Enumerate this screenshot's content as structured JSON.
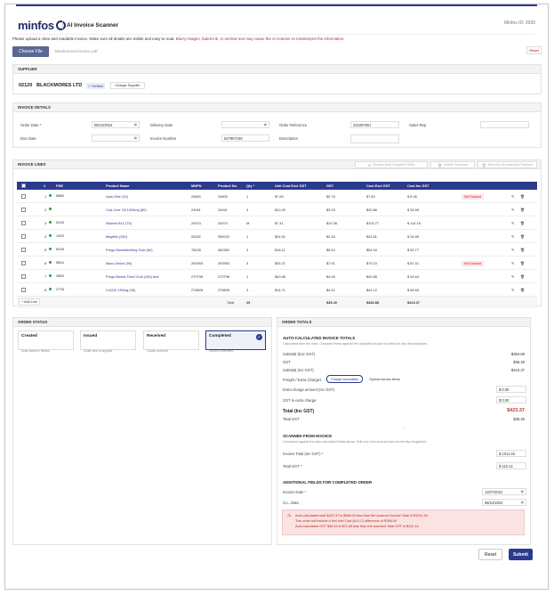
{
  "app": {
    "logo": "minfos",
    "title": "AI Invoice Scanner",
    "minfos_id": "Minfos ID: 2030"
  },
  "note": {
    "text": "Please upload a clear and readable invoice. Make sure all details are visible and easy to read. ",
    "warn": "Blurry images, faded ink, or unclear text may cause the AI scanner to misinterpret the information."
  },
  "file": {
    "button": "Choose File",
    "name": "Blackmores-invoice.pdf",
    "reset": "Reset"
  },
  "supplier": {
    "heading": "SUPPLIER",
    "code": "02120",
    "name": "BLACKMORES LTD",
    "badge": "Verified",
    "change": "Change Supplier"
  },
  "details": {
    "heading": "INVOICE DETAILS",
    "order_date_label": "Order Date *",
    "order_date": "08/12/2024",
    "delivery_date_label": "Delivery Date",
    "delivery_date": "",
    "order_ref_label": "Order Reference",
    "order_ref": "232297801",
    "sales_rep_label": "Sales Rep",
    "sales_rep": "",
    "due_date_label": "Due Date",
    "due_date": "",
    "invoice_no_label": "Invoice Number",
    "invoice_no": "647967198",
    "description_label": "Description",
    "description": ""
  },
  "lines": {
    "heading": "INVOICE LINES",
    "review_btn": "Review New Supplier PDEs",
    "delete_btn": "Delete Selected",
    "remove_btn": "Remove Unmatched Products",
    "headers": [
      "#",
      "PDE",
      "Product Name",
      "MNPN",
      "Product No.",
      "Qty *",
      "Unit Cost Excl GST",
      "GST",
      "Cost Excl GST",
      "Cost Inc GST"
    ],
    "rows": [
      {
        "n": "1",
        "pde": "88660",
        "name": "Lyss-Sine (10)",
        "mnpn": "24600",
        "pno": "24600",
        "qty": "1",
        "unit": "$7.60",
        "gst": "$0.76",
        "cex": "$7.60",
        "cinc": "$ 8.36",
        "status": "Not Stocked"
      },
      {
        "n": "2",
        "pde": "",
        "name": "Cod Liver Oil 1000mg (80)",
        "mnpn": "24941",
        "pno": "24941",
        "qty": "3",
        "unit": "$10.29",
        "gst": "$3.09",
        "cex": "$30.86",
        "cinc": "$ 33.95",
        "status": ""
      },
      {
        "n": "3",
        "pde": "80118",
        "name": "Vitamin B12 (75)",
        "mnpn": "24974",
        "pno": "24974",
        "qty": "M",
        "unit": "$7.41",
        "gst": "$10.38",
        "cex": "$103.77",
        "cinc": "$ 114.15",
        "status": ""
      },
      {
        "n": "4",
        "pde": "11639",
        "name": "MagMin (250)",
        "mnpn": "53492",
        "pno": "355242",
        "qty": "1",
        "unit": "$24.51",
        "gst": "$2.45",
        "cex": "$24.51",
        "cinc": "$ 26.96",
        "status": ""
      },
      {
        "n": "5",
        "pde": "81618",
        "name": "Pregs Breastfeeding Gold (60)",
        "mnpn": "78428",
        "pno": "482382",
        "qty": "3",
        "unit": "$18.11",
        "gst": "$5.43",
        "cex": "$54.34",
        "cinc": "$ 59.77",
        "status": ""
      },
      {
        "n": "6",
        "pde": "88614",
        "name": "Macu-Vision (90)",
        "mnpn": "293993",
        "pno": "293993",
        "qty": "3",
        "unit": "$26.37",
        "gst": "$7.91",
        "cex": "$79.10",
        "cinc": "$ 87.01",
        "status": "Not Stocked"
      },
      {
        "n": "7",
        "pde": "35894",
        "name": "Pregs Breast Feed Gold (180) Anti",
        "mnpn": "270798",
        "pno": "270798",
        "qty": "1",
        "unit": "$40.58",
        "gst": "$4.06",
        "cex": "$40.58",
        "cinc": "$ 44.64",
        "status": ""
      },
      {
        "n": "8",
        "pde": "27736",
        "name": "CoQ10 150mg (30)",
        "mnpn": "278828",
        "pno": "278828",
        "qty": "3",
        "unit": "$14.71",
        "gst": "$4.41",
        "cex": "$44.12",
        "cinc": "$ 48.53",
        "status": ""
      }
    ],
    "add_line": "+ Add Line",
    "total_label": "Total",
    "total_qty": "29",
    "total_gst": "$38.49",
    "total_cex": "$384.88",
    "total_cinc": "$423.37"
  },
  "status": {
    "heading": "ORDER STATUS",
    "cards": [
      {
        "title": "Created",
        "desc": "Draft saved in Minfos"
      },
      {
        "title": "Issued",
        "desc": "Order sent to supplier"
      },
      {
        "title": "Received",
        "desc": "Goods received"
      },
      {
        "title": "Completed",
        "desc": "Invoice processed"
      }
    ]
  },
  "totals": {
    "heading": "ORDER TOTALS",
    "auto_title": "AUTO-CALCULATED INVOICE TOTALS",
    "auto_desc": "Calculated from the lines. Compare these against the uploaded invoice to check for any discrepancies.",
    "sub_ex_label": "Subtotal (Exc GST)",
    "sub_ex": "$384.88",
    "gst_label": "GST",
    "gst": "$38.49",
    "sub_inc_label": "Subtotal (Inc GST)",
    "sub_inc": "$423.37",
    "freight_label": "Freight / Extra Charges",
    "freight_opt1": "Charge separately",
    "freight_opt2": "Spread across items",
    "extra_label": "Extra charge amount (Inc GST)",
    "extra": "$ 0.00",
    "gst_extra_label": "GST in extra charge",
    "gst_extra": "$ 0.00",
    "total_inc_label": "Total (Inc GST)",
    "total_inc": "$423.37",
    "total_gst_label": "Total GST",
    "total_gst": "$38.49",
    "scanned_title": "SCANNED FROM INVOICE",
    "scanned_desc": "Compared against the auto-calculated totals above. Edit only if an amount was incorrectly recognised.",
    "inv_total_label": "Invoice Total (Inc GST) *",
    "inv_total": "$ 1011.46",
    "inv_gst_label": "Total GST *",
    "inv_gst": "$ 110.14",
    "add_title": "ADDITIONAL FIELDS FOR COMPLETED ORDER",
    "inv_date_label": "Invoice Date *",
    "inv_date": "11/07/2024",
    "gl_date_label": "G.L. Date",
    "gl_date": "08/12/2024",
    "alert1": "Auto-calculated total $423.37 is $588.09 less than the scanned Invoice Total of $1011.46.",
    "alert2": "This order will include a Net Unit Cost (N.U.C) difference of $788.09",
    "alert3": "Auto-calculated GST $38.49 is $71.65 less than the scanned Total GST of $110.14."
  },
  "footer": {
    "reset": "Reset",
    "submit": "Submit"
  }
}
